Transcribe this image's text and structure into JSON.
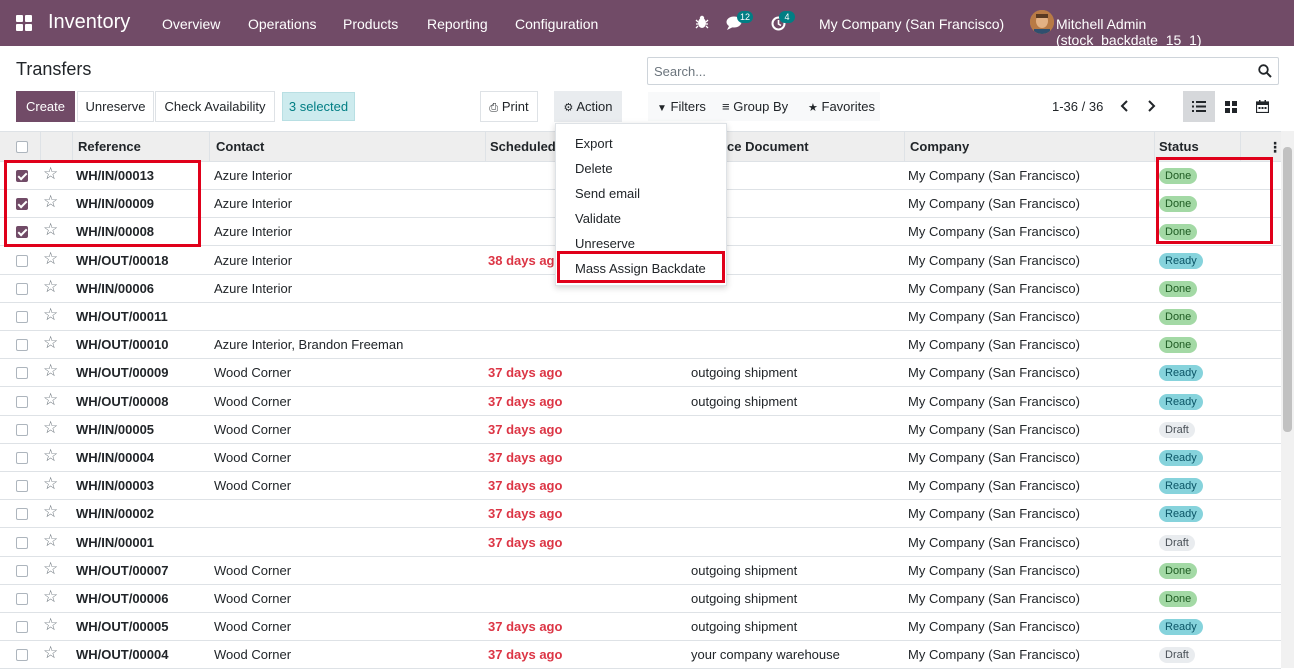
{
  "app": {
    "title": "Inventory",
    "menu": [
      "Overview",
      "Operations",
      "Products",
      "Reporting",
      "Configuration"
    ],
    "messages_count": "12",
    "activities_count": "4",
    "company": "My Company (San Francisco)",
    "user": "Mitchell Admin (stock_backdate_15_1)"
  },
  "page": {
    "title": "Transfers",
    "search_placeholder": "Search...",
    "buttons": {
      "create": "Create",
      "unreserve": "Unreserve",
      "check_availability": "Check Availability",
      "selected": "3 selected",
      "print": "Print",
      "action": "Action"
    },
    "filters": {
      "filters": "Filters",
      "group_by": "Group By",
      "favorites": "Favorites"
    },
    "pager": "1-36 / 36"
  },
  "columns": {
    "reference": "Reference",
    "contact": "Contact",
    "scheduled": "Scheduled",
    "source": "ce Document",
    "company": "Company",
    "status": "Status"
  },
  "action_menu": [
    "Export",
    "Delete",
    "Send email",
    "Validate",
    "Unreserve",
    "Mass Assign Backdate"
  ],
  "rows": [
    {
      "checked": true,
      "ref": "WH/IN/00013",
      "contact": "Azure Interior",
      "sched": "",
      "src": "",
      "company": "My Company (San Francisco)",
      "status": "Done"
    },
    {
      "checked": true,
      "ref": "WH/IN/00009",
      "contact": "Azure Interior",
      "sched": "",
      "src": "",
      "company": "My Company (San Francisco)",
      "status": "Done"
    },
    {
      "checked": true,
      "ref": "WH/IN/00008",
      "contact": "Azure Interior",
      "sched": "",
      "src": "",
      "company": "My Company (San Francisco)",
      "status": "Done"
    },
    {
      "checked": false,
      "ref": "WH/OUT/00018",
      "contact": "Azure Interior",
      "sched": "38 days ag",
      "src": "",
      "company": "My Company (San Francisco)",
      "status": "Ready"
    },
    {
      "checked": false,
      "ref": "WH/IN/00006",
      "contact": "Azure Interior",
      "sched": "",
      "src": "",
      "company": "My Company (San Francisco)",
      "status": "Done"
    },
    {
      "checked": false,
      "ref": "WH/OUT/00011",
      "contact": "",
      "sched": "",
      "src": "",
      "company": "My Company (San Francisco)",
      "status": "Done"
    },
    {
      "checked": false,
      "ref": "WH/OUT/00010",
      "contact": "Azure Interior, Brandon Freeman",
      "sched": "",
      "src": "",
      "company": "My Company (San Francisco)",
      "status": "Done"
    },
    {
      "checked": false,
      "ref": "WH/OUT/00009",
      "contact": "Wood Corner",
      "sched": "37 days ago",
      "src": "outgoing shipment",
      "company": "My Company (San Francisco)",
      "status": "Ready"
    },
    {
      "checked": false,
      "ref": "WH/OUT/00008",
      "contact": "Wood Corner",
      "sched": "37 days ago",
      "src": "outgoing shipment",
      "company": "My Company (San Francisco)",
      "status": "Ready"
    },
    {
      "checked": false,
      "ref": "WH/IN/00005",
      "contact": "Wood Corner",
      "sched": "37 days ago",
      "src": "",
      "company": "My Company (San Francisco)",
      "status": "Draft"
    },
    {
      "checked": false,
      "ref": "WH/IN/00004",
      "contact": "Wood Corner",
      "sched": "37 days ago",
      "src": "",
      "company": "My Company (San Francisco)",
      "status": "Ready"
    },
    {
      "checked": false,
      "ref": "WH/IN/00003",
      "contact": "Wood Corner",
      "sched": "37 days ago",
      "src": "",
      "company": "My Company (San Francisco)",
      "status": "Ready"
    },
    {
      "checked": false,
      "ref": "WH/IN/00002",
      "contact": "",
      "sched": "37 days ago",
      "src": "",
      "company": "My Company (San Francisco)",
      "status": "Ready"
    },
    {
      "checked": false,
      "ref": "WH/IN/00001",
      "contact": "",
      "sched": "37 days ago",
      "src": "",
      "company": "My Company (San Francisco)",
      "status": "Draft"
    },
    {
      "checked": false,
      "ref": "WH/OUT/00007",
      "contact": "Wood Corner",
      "sched": "",
      "src": "outgoing shipment",
      "company": "My Company (San Francisco)",
      "status": "Done"
    },
    {
      "checked": false,
      "ref": "WH/OUT/00006",
      "contact": "Wood Corner",
      "sched": "",
      "src": "outgoing shipment",
      "company": "My Company (San Francisco)",
      "status": "Done"
    },
    {
      "checked": false,
      "ref": "WH/OUT/00005",
      "contact": "Wood Corner",
      "sched": "37 days ago",
      "src": "outgoing shipment",
      "company": "My Company (San Francisco)",
      "status": "Ready"
    },
    {
      "checked": false,
      "ref": "WH/OUT/00004",
      "contact": "Wood Corner",
      "sched": "37 days ago",
      "src": "your company warehouse",
      "company": "My Company (San Francisco)",
      "status": "Draft"
    }
  ],
  "colors": {
    "brand": "#714b67",
    "highlight": "#e0001a",
    "danger": "#dc3545"
  }
}
